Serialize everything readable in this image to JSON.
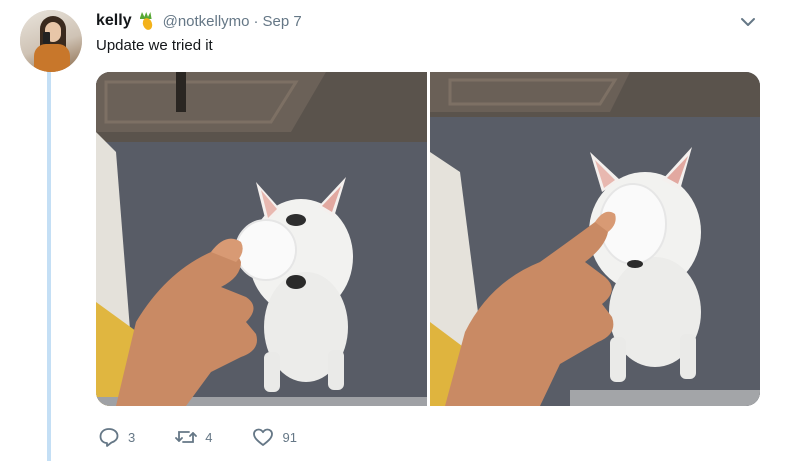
{
  "tweet": {
    "name": "kelly",
    "name_emoji": "pineapple-icon",
    "handle": "@notkellymo",
    "separator": "·",
    "date": "Sep 7",
    "text": "Update we tried it"
  },
  "media": {
    "images": [
      {
        "icon": "photo-dog-with-ball"
      },
      {
        "icon": "photo-dog-behind-ball"
      }
    ]
  },
  "actions": {
    "reply_count": "3",
    "retweet_count": "4",
    "like_count": "91"
  },
  "colors": {
    "thread_line": "#c4dff5",
    "secondary_text": "#657786",
    "primary_text": "#14171a"
  }
}
